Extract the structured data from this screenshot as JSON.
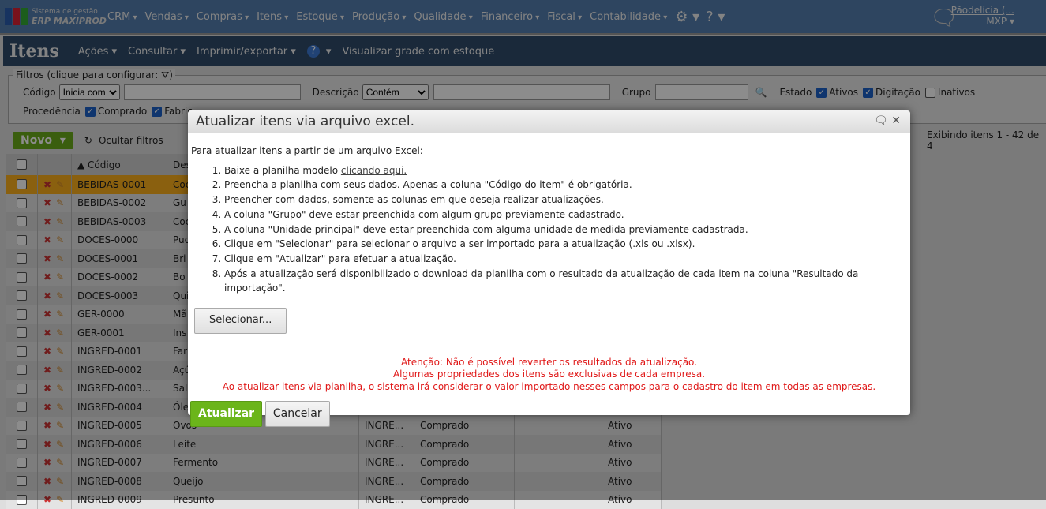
{
  "nav": {
    "logo_line1": "Sistema de gestão",
    "logo_line2": "ERP MAXIPROD",
    "menus": [
      "CRM",
      "Vendas",
      "Compras",
      "Itens",
      "Estoque",
      "Produção",
      "Qualidade",
      "Financeiro",
      "Fiscal",
      "Contabilidade"
    ],
    "company": "Pãodelícia (...",
    "user": "MXP ▾"
  },
  "titlebar": {
    "title": "Itens",
    "menus": [
      "Ações ▾",
      "Consultar ▾",
      "Imprimir/exportar ▾"
    ],
    "help": "?",
    "after_help": "▾",
    "grade": "Visualizar grade com estoque"
  },
  "filters": {
    "legend": "Filtros (clique para configurar: ⛛)",
    "codigo_label": "Código",
    "codigo_op": "Inicia com",
    "descricao_label": "Descrição",
    "descricao_op": "Contém",
    "grupo_label": "Grupo",
    "estado_label": "Estado",
    "estado": [
      {
        "label": "Ativos",
        "checked": true
      },
      {
        "label": "Digitação",
        "checked": true
      },
      {
        "label": "Inativos",
        "checked": false
      }
    ],
    "procedencia_label": "Procedência",
    "procedencia": [
      {
        "label": "Comprado",
        "checked": true
      },
      {
        "label": "Fabric",
        "checked": true
      }
    ]
  },
  "toolbar": {
    "novo": "Novo",
    "refresh": "↻",
    "ocultar": "Ocultar filtros",
    "exibindo": "Exibindo itens 1 - 42 de 4"
  },
  "grid": {
    "header": {
      "codigo": "▲ Código",
      "descricao": "Des"
    },
    "rows": [
      {
        "codigo": "BEBIDAS-0001",
        "desc": "Coc",
        "sel": true
      },
      {
        "codigo": "BEBIDAS-0002",
        "desc": "Gu"
      },
      {
        "codigo": "BEBIDAS-0003",
        "desc": "Coc"
      },
      {
        "codigo": "DOCES-0000",
        "desc": "Pud"
      },
      {
        "codigo": "DOCES-0001",
        "desc": "Bri"
      },
      {
        "codigo": "DOCES-0002",
        "desc": "Bo"
      },
      {
        "codigo": "DOCES-0003",
        "desc": "Qui"
      },
      {
        "codigo": "GER-0000",
        "desc": "Mã"
      },
      {
        "codigo": "GER-0001",
        "desc": "Ins"
      },
      {
        "codigo": "INGRED-0001",
        "desc": "Far"
      },
      {
        "codigo": "INGRED-0002",
        "desc": "Açú"
      },
      {
        "codigo": "INGRED-0003...",
        "desc": "Sal"
      },
      {
        "codigo": "INGRED-0004",
        "desc": "Óle"
      },
      {
        "codigo": "INGRED-0005",
        "desc": "Ovos",
        "grupo": "INGRE...",
        "proc": "Comprado",
        "estado": "Ativo"
      },
      {
        "codigo": "INGRED-0006",
        "desc": "Leite",
        "grupo": "INGRE...",
        "proc": "Comprado",
        "estado": "Ativo"
      },
      {
        "codigo": "INGRED-0007",
        "desc": "Fermento",
        "grupo": "INGRE...",
        "proc": "Comprado",
        "estado": "Ativo"
      },
      {
        "codigo": "INGRED-0008",
        "desc": "Queijo",
        "grupo": "INGRE...",
        "proc": "Comprado",
        "estado": "Ativo"
      },
      {
        "codigo": "INGRED-0009",
        "desc": "Presunto",
        "grupo": "INGRE...",
        "proc": "Comprado",
        "estado": "Ativo"
      }
    ]
  },
  "dialog": {
    "title": "Atualizar itens via arquivo excel.",
    "intro": "Para atualizar itens a partir de um arquivo Excel:",
    "step1_prefix": "Baixe a planilha modelo ",
    "step1_link": "clicando aqui.",
    "steps": [
      "Preencha a planilha com seus dados. Apenas a coluna \"Código do item\" é obrigatória.",
      "Preencher com dados, somente as colunas em que deseja realizar atualizações.",
      "A coluna \"Grupo\" deve estar preenchida com algum grupo previamente cadastrado.",
      "A coluna \"Unidade principal\" deve estar preenchida com alguma unidade de medida previamente cadastrada.",
      "Clique em \"Selecionar\" para selecionar o arquivo a ser importado para a atualização (.xls ou .xlsx).",
      "Clique em \"Atualizar\" para efetuar a atualização.",
      "Após a atualização será disponibilizado o download da planilha com o resultado da atualização de cada item na coluna \"Resultado da importação\"."
    ],
    "selecionar": "Selecionar...",
    "warnings": [
      "Atenção: Não é possível reverter os resultados da atualização.",
      "Algumas propriedades dos itens são exclusivas de cada empresa.",
      "Ao atualizar itens via planilha, o sistema irá considerar o valor importado nesses campos para o cadastro do item em todas as empresas."
    ],
    "atualizar": "Atualizar",
    "cancelar": "Cancelar"
  }
}
